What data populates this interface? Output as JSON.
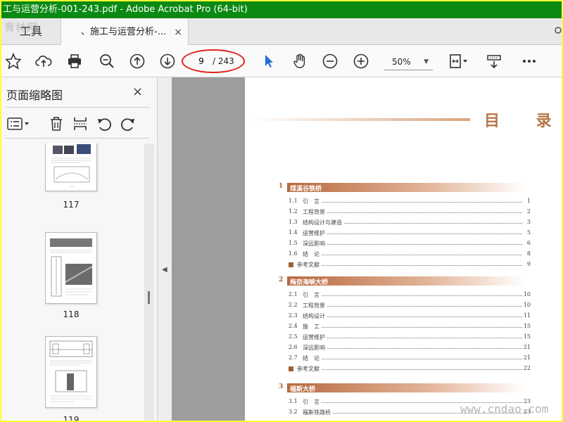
{
  "window": {
    "title": "工与运营分析-001-243.pdf - Adobe Acrobat Pro (64-bit)"
  },
  "watermark": {
    "logo": "青林网",
    "site": "www.cndao.com"
  },
  "tabs": {
    "tools": "工具",
    "document": "、施工与运营分析-...",
    "close": "×"
  },
  "toolbar": {
    "page_current": "9",
    "page_total": "/ 243",
    "zoom": "50%",
    "icons": [
      "star-icon",
      "cloud-upload-icon",
      "print-icon",
      "zoom-search-icon",
      "arrow-up-circle-icon",
      "arrow-down-circle-icon",
      "select-arrow-icon",
      "hand-icon",
      "zoom-out-icon",
      "zoom-in-icon",
      "page-fit-icon",
      "scroll-mode-icon",
      "more-icon"
    ]
  },
  "sidebar": {
    "title": "页面缩略图",
    "close": "×",
    "thumbnails": [
      {
        "label": "117"
      },
      {
        "label": "118"
      },
      {
        "label": "119"
      }
    ]
  },
  "document": {
    "heading": "目 录 —",
    "chapters": [
      {
        "num": "1",
        "title": "煤溪谷铁桥",
        "entries": [
          {
            "num": "1.1",
            "title": "引　言",
            "page": "1"
          },
          {
            "num": "1.2",
            "title": "工程背景",
            "page": "2"
          },
          {
            "num": "1.3",
            "title": "结构设计与建造",
            "page": "3"
          },
          {
            "num": "1.4",
            "title": "运营维护",
            "page": "5"
          },
          {
            "num": "1.5",
            "title": "深远影响",
            "page": "6"
          },
          {
            "num": "1.6",
            "title": "结　论",
            "page": "8"
          }
        ],
        "ref": {
          "title": "参考文献",
          "page": "9"
        }
      },
      {
        "num": "2",
        "title": "梅奈海峡大桥",
        "entries": [
          {
            "num": "2.1",
            "title": "引　言",
            "page": "10"
          },
          {
            "num": "2.2",
            "title": "工程背景",
            "page": "10"
          },
          {
            "num": "2.3",
            "title": "结构设计",
            "page": "11"
          },
          {
            "num": "2.4",
            "title": "施　工",
            "page": "15"
          },
          {
            "num": "2.5",
            "title": "运营维护",
            "page": "15"
          },
          {
            "num": "2.6",
            "title": "深远影响",
            "page": "21"
          },
          {
            "num": "2.7",
            "title": "结　论",
            "page": "21"
          }
        ],
        "ref": {
          "title": "参考文献",
          "page": "22"
        }
      },
      {
        "num": "3",
        "title": "福斯大桥",
        "entries": [
          {
            "num": "3.1",
            "title": "引　言",
            "page": "23"
          },
          {
            "num": "3.2",
            "title": "福斯铁路桥",
            "page": "23"
          }
        ]
      }
    ]
  }
}
